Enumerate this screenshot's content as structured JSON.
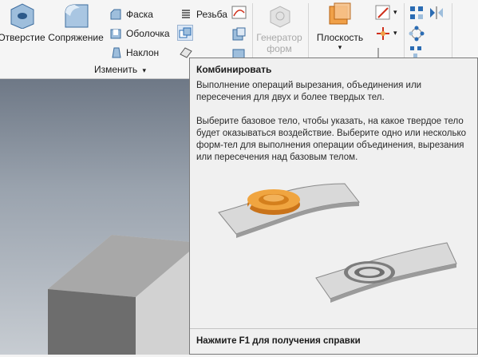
{
  "ribbon": {
    "hole_label": "Отверстие",
    "fillet_label": "Сопряжение",
    "chamfer_label": "Фаска",
    "shell_label": "Оболочка",
    "draft_label": "Наклон",
    "thread_label": "Резьба",
    "generator_label_1": "Генератор",
    "generator_label_2": "форм",
    "plane_label": "Плоскость",
    "modify_panel": "Изменить",
    "dropdown_arrow": "▾"
  },
  "tooltip": {
    "title": "Комбинировать",
    "para1": "Выполнение операций вырезания, объединения или пересечения для двух и более твердых тел.",
    "para2": "Выберите базовое тело, чтобы указать, на какое твердое тело будет оказываться воздействие. Выберите одно или несколько форм-тел для выполнения операции объединения, вырезания или пересечения над базовым телом.",
    "help": "Нажмите F1 для получения справки"
  },
  "colors": {
    "accent_orange": "#e8891e",
    "icon_blue": "#2b6cb3",
    "tooltip_bg": "#f0f0f0"
  }
}
